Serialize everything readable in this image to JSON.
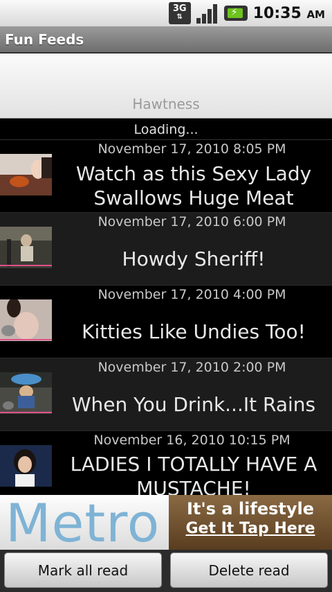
{
  "status_bar": {
    "network": "3G",
    "time": "10:35",
    "ampm": "AM"
  },
  "app": {
    "title": "Fun Feeds"
  },
  "tab": {
    "label": "Hawtness"
  },
  "loading_text": "Loading...",
  "feed_items": [
    {
      "date": "November 17, 2010 8:05 PM",
      "title": "Watch as this Sexy Lady Swallows Huge Meat"
    },
    {
      "date": "November 17, 2010 6:00 PM",
      "title": "Howdy Sheriff!"
    },
    {
      "date": "November 17, 2010 4:00 PM",
      "title": "Kitties Like Undies Too!"
    },
    {
      "date": "November 17, 2010 2:00 PM",
      "title": "When You Drink...It Rains"
    },
    {
      "date": "November 16, 2010 10:15 PM",
      "title": "LADIES I TOTALLY HAVE A MUSTACHE!"
    }
  ],
  "ad": {
    "brand": "Metro",
    "tagline": "It's a lifestyle",
    "cta": "Get It Tap Here"
  },
  "buttons": {
    "mark_all_read": "Mark all read",
    "delete_read": "Delete read"
  },
  "colors": {
    "ad_brand": "#7fb3d5",
    "ad_panel": "#6e4f2c",
    "title_bar": "#808080"
  }
}
